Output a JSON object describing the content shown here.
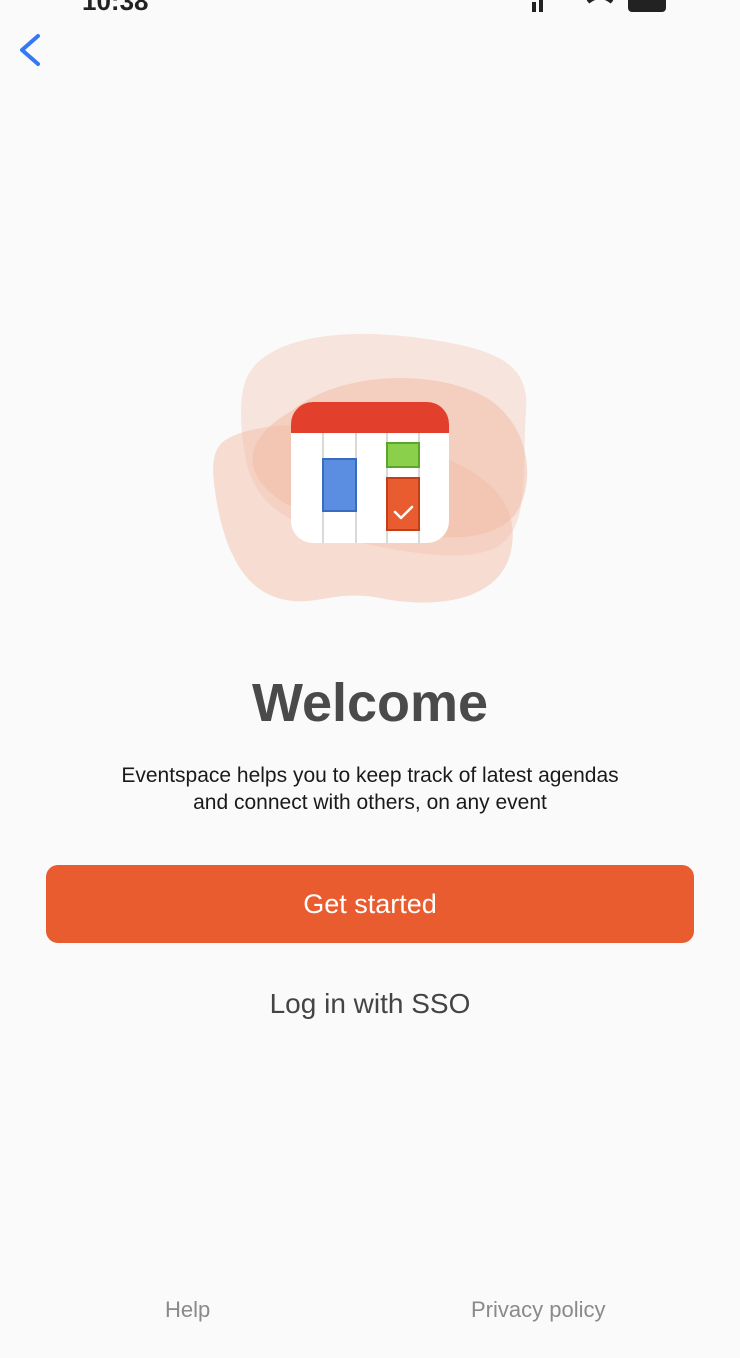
{
  "status_bar": {
    "time": "10:38"
  },
  "colors": {
    "accent": "#e85c2f",
    "back_icon": "#3478f6",
    "title_text": "#4a4a4a",
    "footer_text": "#8a8a8a"
  },
  "icons": {
    "back": "chevron-left-icon",
    "hero": "calendar-icon",
    "check": "checkmark-icon"
  },
  "welcome": {
    "title": "Welcome",
    "description_line1": "Eventspace helps you to keep track of latest agendas",
    "description_line2": "and connect with others, on any event"
  },
  "actions": {
    "get_started_label": "Get started",
    "sso_label": "Log in with SSO"
  },
  "footer": {
    "help_label": "Help",
    "privacy_label": "Privacy policy"
  }
}
